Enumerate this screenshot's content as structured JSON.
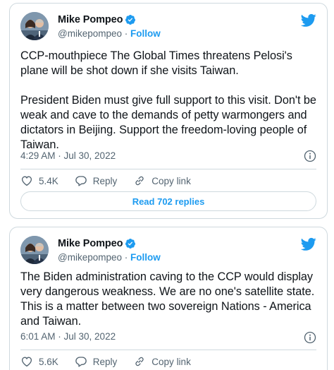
{
  "tweets": [
    {
      "author": {
        "name": "Mike Pompeo",
        "handle": "@mikepompeo",
        "follow_label": "Follow"
      },
      "text": "CCP-mouthpiece The Global Times threatens Pelosi's\nplane will be shot down if she visits Taiwan.\n\nPresident Biden must give full support to this visit. Don't be\nweak and cave to the demands of petty warmongers and\ndictators in Beijing. Support the freedom-loving people of\nTaiwan.",
      "timestamp": "4:29 AM · Jul 30, 2022",
      "likes": "5.4K",
      "reply_label": "Reply",
      "copy_link_label": "Copy link",
      "read_replies_label": "Read 702 replies"
    },
    {
      "author": {
        "name": "Mike Pompeo",
        "handle": "@mikepompeo",
        "follow_label": "Follow"
      },
      "text": "The Biden administration caving to the CCP would display\nvery dangerous weakness. We are no one's satellite state.\nThis is a matter between two sovereign Nations - America\nand Taiwan.",
      "timestamp": "6:01 AM · Jul 30, 2022",
      "likes": "5.6K",
      "reply_label": "Reply",
      "copy_link_label": "Copy link"
    }
  ],
  "colors": {
    "accent": "#1d9bf0",
    "text_primary": "#0f1419",
    "text_secondary": "#536471",
    "border": "#cfd9de"
  },
  "icons": [
    "verified-badge-icon",
    "twitter-bird-icon",
    "info-icon",
    "heart-icon",
    "reply-icon",
    "link-icon"
  ]
}
